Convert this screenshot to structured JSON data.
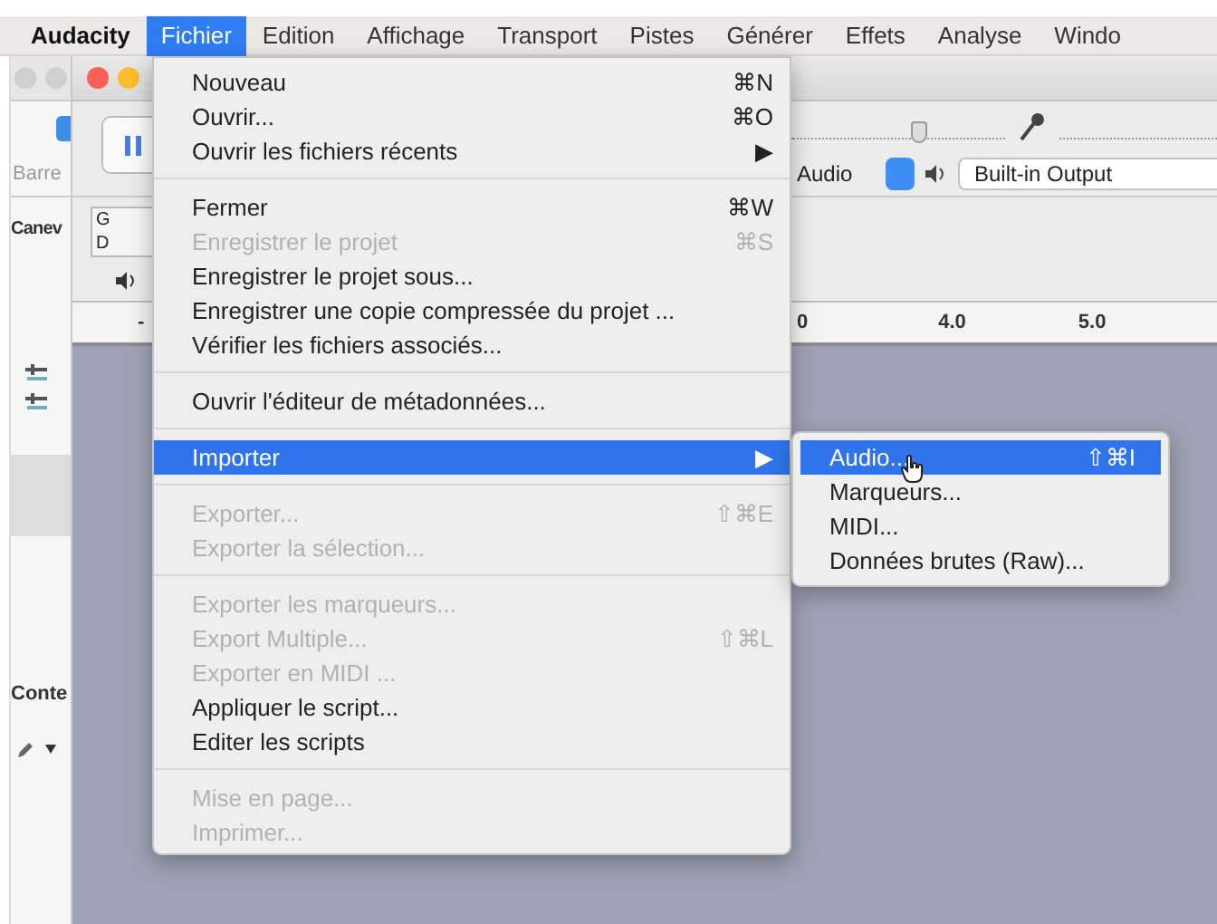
{
  "menubar": {
    "items": [
      {
        "label": "Audacity",
        "kind": "app",
        "selected": false
      },
      {
        "label": "Fichier",
        "kind": "menu",
        "selected": true
      },
      {
        "label": "Edition",
        "kind": "menu",
        "selected": false
      },
      {
        "label": "Affichage",
        "kind": "menu",
        "selected": false
      },
      {
        "label": "Transport",
        "kind": "menu",
        "selected": false
      },
      {
        "label": "Pistes",
        "kind": "menu",
        "selected": false
      },
      {
        "label": "Générer",
        "kind": "menu",
        "selected": false
      },
      {
        "label": "Effets",
        "kind": "menu",
        "selected": false
      },
      {
        "label": "Analyse",
        "kind": "menu",
        "selected": false
      },
      {
        "label": "Windo",
        "kind": "menu",
        "selected": false
      }
    ]
  },
  "window": {
    "volume_slider": {
      "level": 0.6
    },
    "side_labels": [
      "Barre",
      "Canev",
      "Conte"
    ],
    "meter_channels": [
      "G",
      "D"
    ],
    "audio_host": "Audio",
    "output_device": "Built-in Output",
    "ruler_labels": [
      "-",
      "0",
      "4.0",
      "5.0"
    ]
  },
  "file_menu": {
    "items": [
      {
        "kind": "item",
        "label": "Nouveau",
        "shortcut": "⌘N",
        "disabled": false,
        "selected": false
      },
      {
        "kind": "item",
        "label": "Ouvrir...",
        "shortcut": "⌘O",
        "disabled": false,
        "selected": false
      },
      {
        "kind": "item",
        "label": "Ouvrir les fichiers récents",
        "shortcut": "▶",
        "disabled": false,
        "selected": false
      },
      {
        "kind": "separator"
      },
      {
        "kind": "item",
        "label": "Fermer",
        "shortcut": "⌘W",
        "disabled": false,
        "selected": false
      },
      {
        "kind": "item",
        "label": "Enregistrer le projet",
        "shortcut": "⌘S",
        "disabled": true,
        "selected": false
      },
      {
        "kind": "item",
        "label": "Enregistrer le projet sous...",
        "disabled": false,
        "selected": false
      },
      {
        "kind": "item",
        "label": "Enregistrer une copie compressée du projet ...",
        "disabled": false,
        "selected": false
      },
      {
        "kind": "item",
        "label": "Vérifier les fichiers associés...",
        "disabled": false,
        "selected": false
      },
      {
        "kind": "separator"
      },
      {
        "kind": "item",
        "label": "Ouvrir l'éditeur de métadonnées...",
        "disabled": false,
        "selected": false
      },
      {
        "kind": "separator"
      },
      {
        "kind": "item",
        "label": "Importer",
        "shortcut": "▶",
        "disabled": false,
        "selected": true
      },
      {
        "kind": "separator"
      },
      {
        "kind": "item",
        "label": "Exporter...",
        "shortcut": "⇧⌘E",
        "disabled": true,
        "selected": false
      },
      {
        "kind": "item",
        "label": "Exporter la sélection...",
        "disabled": true,
        "selected": false
      },
      {
        "kind": "separator"
      },
      {
        "kind": "item",
        "label": "Exporter les marqueurs...",
        "disabled": true,
        "selected": false
      },
      {
        "kind": "item",
        "label": "Export Multiple...",
        "shortcut": "⇧⌘L",
        "disabled": true,
        "selected": false
      },
      {
        "kind": "item",
        "label": "Exporter en MIDI ...",
        "disabled": true,
        "selected": false
      },
      {
        "kind": "item",
        "label": "Appliquer le script...",
        "disabled": false,
        "selected": false
      },
      {
        "kind": "item",
        "label": "Editer les scripts",
        "disabled": false,
        "selected": false
      },
      {
        "kind": "separator"
      },
      {
        "kind": "item",
        "label": "Mise en page...",
        "disabled": true,
        "selected": false
      },
      {
        "kind": "item",
        "label": "Imprimer...",
        "disabled": true,
        "selected": false
      }
    ]
  },
  "import_submenu": {
    "items": [
      {
        "kind": "item",
        "label": "Audio...",
        "shortcut": "⇧⌘I",
        "disabled": false,
        "selected": true
      },
      {
        "kind": "item",
        "label": "Marqueurs...",
        "disabled": false,
        "selected": false
      },
      {
        "kind": "item",
        "label": "MIDI...",
        "disabled": false,
        "selected": false
      },
      {
        "kind": "item",
        "label": "Données brutes (Raw)...",
        "disabled": false,
        "selected": false
      }
    ]
  }
}
